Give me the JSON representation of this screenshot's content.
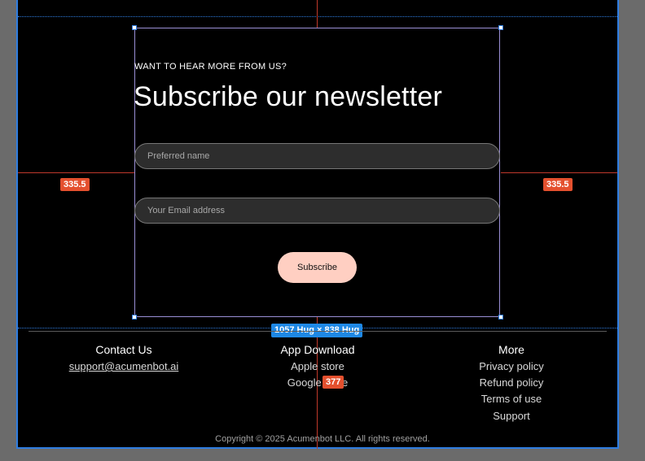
{
  "newsletter": {
    "eyebrow": "WANT TO HEAR MORE FROM US?",
    "headline": "Subscribe our newsletter",
    "name_placeholder": "Preferred name",
    "email_placeholder": "Your Email address",
    "subscribe_label": "Subscribe"
  },
  "overlay": {
    "spacing_left": "335.5",
    "spacing_right": "335.5",
    "size_label": "1057 Hug × 838 Hug",
    "spacing_bottom": "377"
  },
  "footer": {
    "contact": {
      "title": "Contact Us",
      "email": "support@acumenbot.ai"
    },
    "app": {
      "title": "App Download",
      "apple": "Apple store",
      "google": "Google store"
    },
    "more": {
      "title": "More",
      "links": [
        "Privacy policy",
        "Refund policy",
        "Terms of use",
        "Support"
      ]
    },
    "copyright": "Copyright © 2025 Acumenbot LLC. All rights reserved."
  },
  "colors": {
    "accent_button": "#ffcfc2",
    "selection_blue": "#2f7de1",
    "measure_red": "#e4502e"
  }
}
